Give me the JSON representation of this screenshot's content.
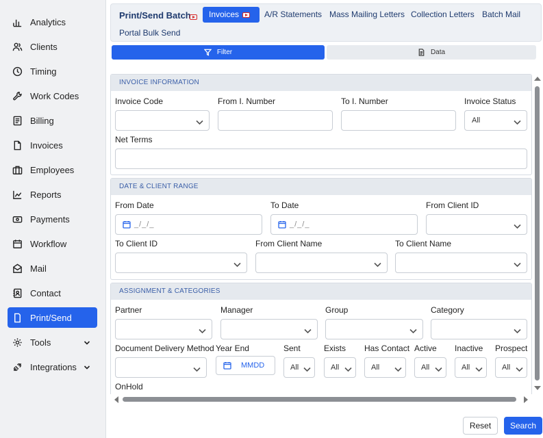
{
  "sidebar": {
    "items": [
      {
        "label": "Analytics",
        "icon": "analytics-icon"
      },
      {
        "label": "Clients",
        "icon": "clients-icon"
      },
      {
        "label": "Timing",
        "icon": "clock-icon"
      },
      {
        "label": "Work Codes",
        "icon": "wrench-icon"
      },
      {
        "label": "Billing",
        "icon": "billing-icon"
      },
      {
        "label": "Invoices",
        "icon": "document-icon"
      },
      {
        "label": "Employees",
        "icon": "briefcase-icon"
      },
      {
        "label": "Reports",
        "icon": "chart-icon"
      },
      {
        "label": "Payments",
        "icon": "payments-icon"
      },
      {
        "label": "Workflow",
        "icon": "calendar-icon"
      },
      {
        "label": "Mail",
        "icon": "mail-icon"
      },
      {
        "label": "Contact",
        "icon": "contact-icon"
      },
      {
        "label": "Print/Send",
        "icon": "printer-icon",
        "active": true
      },
      {
        "label": "Tools",
        "icon": "gear-icon"
      },
      {
        "label": "Integrations",
        "icon": "plug-icon"
      }
    ]
  },
  "header": {
    "title": "Print/Send Batch",
    "tabs": [
      {
        "label": "Invoices",
        "active": true
      },
      {
        "label": "A/R Statements"
      },
      {
        "label": "Mass Mailing Letters"
      },
      {
        "label": "Collection Letters"
      },
      {
        "label": "Batch Mail"
      },
      {
        "label": "Portal Bulk Send"
      }
    ]
  },
  "view_toggle": {
    "filter": "Filter",
    "data": "Data"
  },
  "sections": {
    "invoice_info": {
      "title": "INVOICE INFORMATION",
      "invoice_code": "Invoice Code",
      "from_number": "From I. Number",
      "to_number": "To I. Number",
      "invoice_status": "Invoice Status",
      "invoice_status_value": "All",
      "net_terms": "Net Terms"
    },
    "date_client": {
      "title": "DATE & CLIENT RANGE",
      "from_date": "From Date",
      "to_date": "To Date",
      "date_placeholder": "_/_/_",
      "from_client_id": "From Client ID",
      "to_client_id": "To Client ID",
      "from_client_name": "From Client Name",
      "to_client_name": "To Client Name"
    },
    "assignment": {
      "title": "ASSIGNMENT & CATEGORIES",
      "partner": "Partner",
      "manager": "Manager",
      "group": "Group",
      "category": "Category",
      "delivery_method": "Document Delivery Method",
      "year_end": "Year End",
      "year_end_placeholder": "MMDD",
      "sent": "Sent",
      "exists": "Exists",
      "has_contact": "Has Contact",
      "active": "Active",
      "inactive": "Inactive",
      "prospect": "Prospect",
      "all_value": "All",
      "onhold": "OnHold"
    }
  },
  "actions": {
    "reset": "Reset",
    "search": "Search"
  },
  "colors": {
    "accent": "#2563eb",
    "title": "#1e3a6e",
    "section_header": "#3b5fa8",
    "video_icon": "#d62828"
  }
}
